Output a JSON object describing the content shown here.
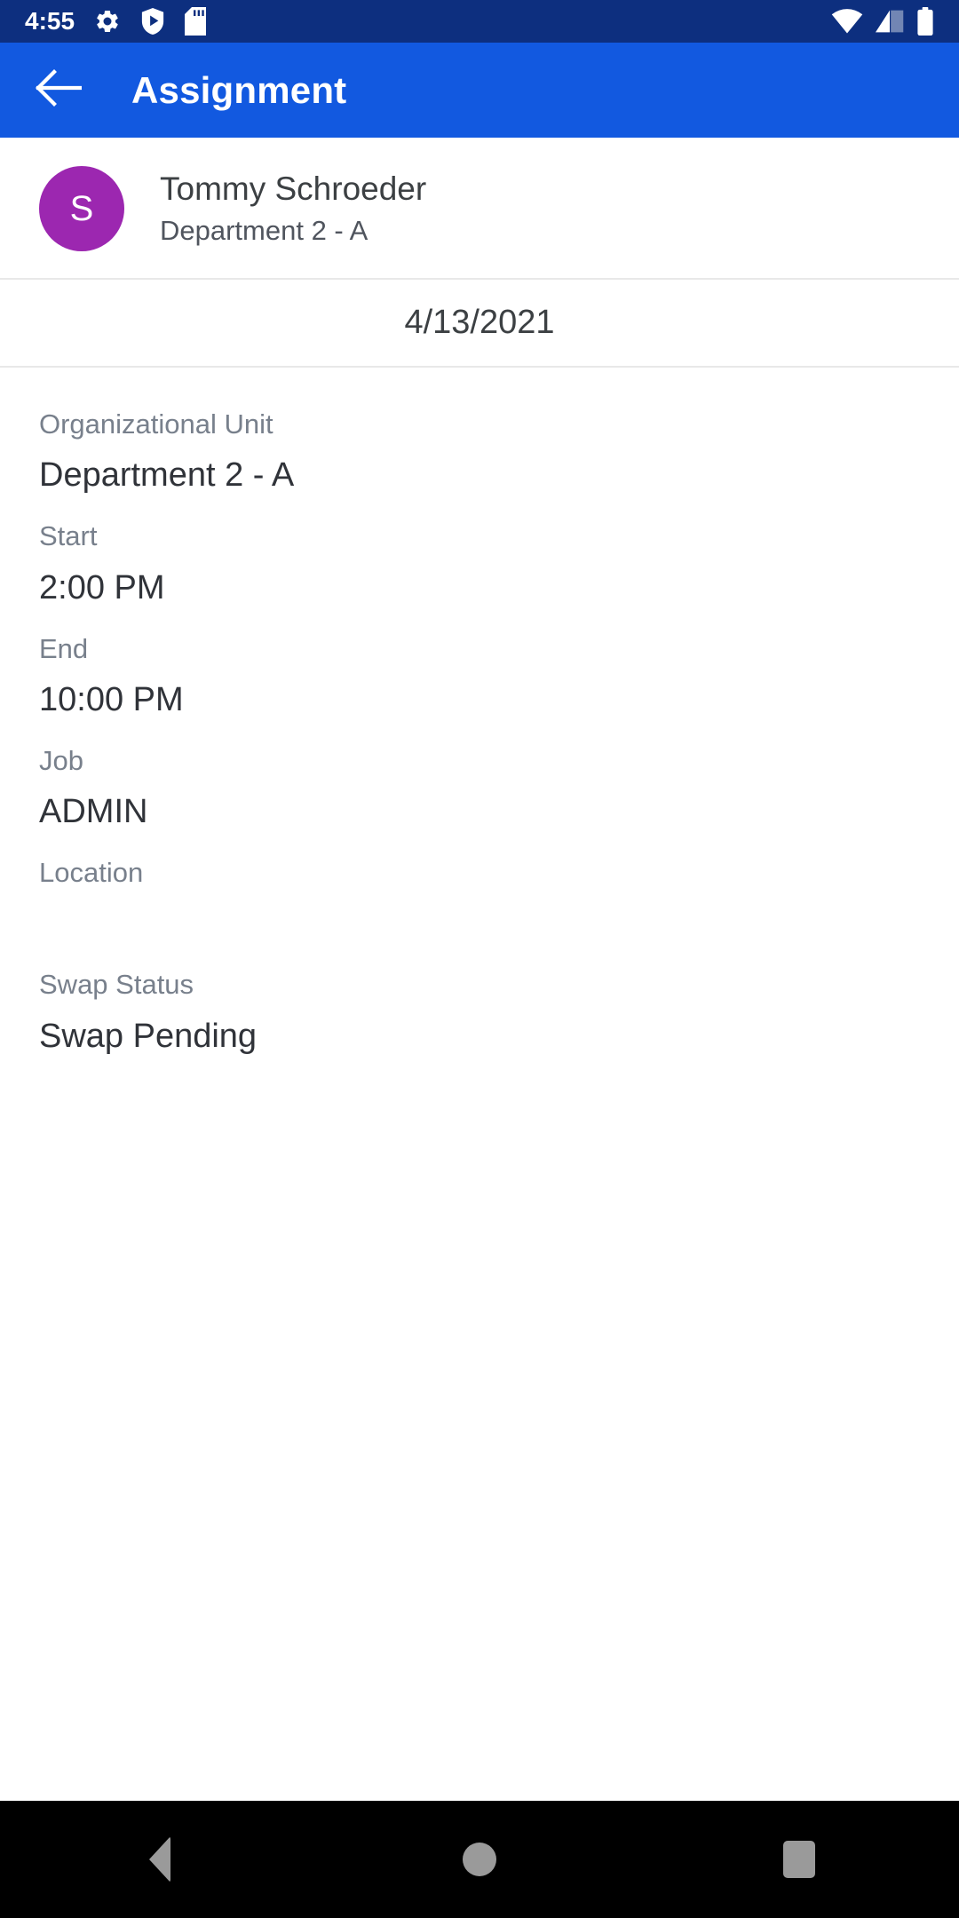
{
  "status_bar": {
    "time": "4:55",
    "background": "#0d2f7f",
    "left_icons": [
      "gear-icon",
      "shield-play-icon",
      "sd-card-icon"
    ],
    "right_icons": [
      "wifi-icon",
      "cell-signal-icon",
      "battery-icon"
    ]
  },
  "app_bar": {
    "title": "Assignment",
    "back_icon": "arrow-left-icon",
    "background": "#1259e0"
  },
  "user": {
    "avatar_initial": "S",
    "avatar_color": "#9c27b0",
    "name": "Tommy Schroeder",
    "subtitle": "Department 2 - A"
  },
  "date": {
    "value": "4/13/2021"
  },
  "details": [
    {
      "label": "Organizational Unit",
      "value": "Department 2 - A"
    },
    {
      "label": "Start",
      "value": "2:00 PM"
    },
    {
      "label": "End",
      "value": "10:00 PM"
    },
    {
      "label": "Job",
      "value": "ADMIN"
    },
    {
      "label": "Location",
      "value": ""
    },
    {
      "label": "Swap Status",
      "value": "Swap Pending"
    }
  ],
  "nav_bar": {
    "background": "#000000",
    "buttons": [
      "back-triangle-icon",
      "home-circle-icon",
      "recents-square-icon"
    ]
  }
}
